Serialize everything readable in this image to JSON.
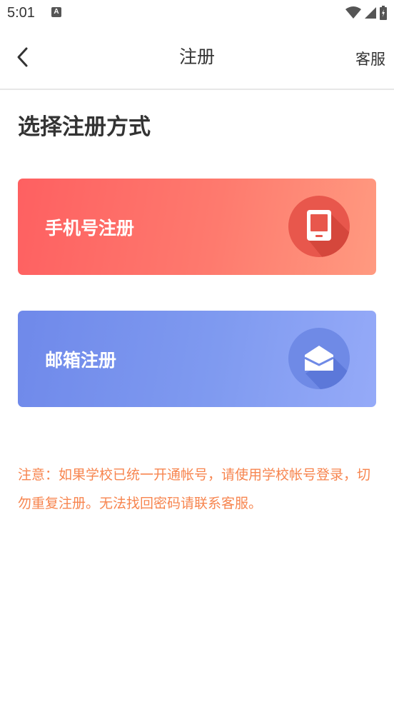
{
  "status_bar": {
    "time": "5:01",
    "indicator_letter": "A"
  },
  "nav": {
    "title": "注册",
    "service_label": "客服"
  },
  "page": {
    "heading": "选择注册方式"
  },
  "options": [
    {
      "label": "手机号注册",
      "icon": "phone-icon"
    },
    {
      "label": "邮箱注册",
      "icon": "mail-icon"
    }
  ],
  "notice": {
    "text": "注意：如果学校已统一开通帐号，请使用学校帐号登录，切勿重复注册。无法找回密码请联系客服。"
  },
  "colors": {
    "phone_card_start": "#fe6061",
    "phone_card_end": "#ff9a80",
    "email_card_start": "#6f89ea",
    "email_card_end": "#95aaf8",
    "notice_text": "#f7854f"
  }
}
